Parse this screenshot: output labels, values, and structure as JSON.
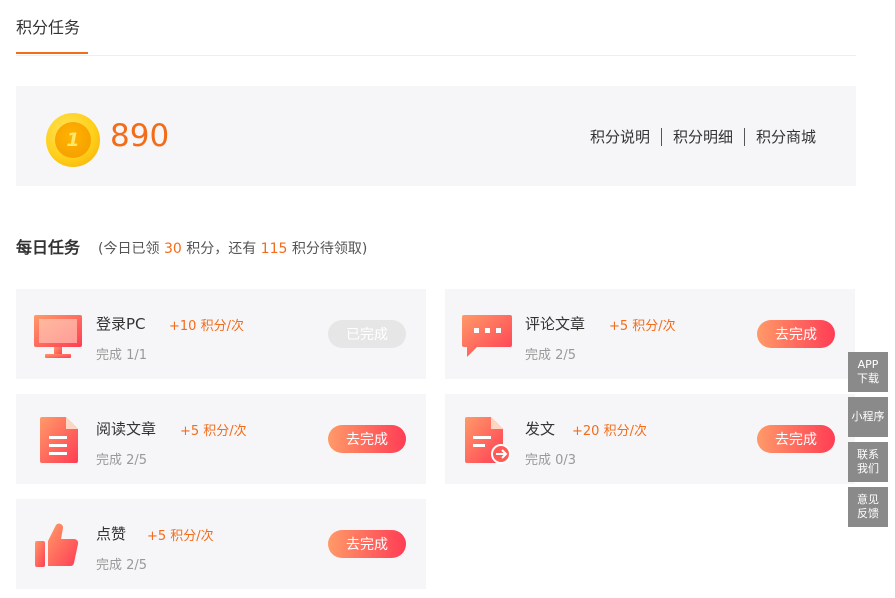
{
  "tabs": {
    "active": "积分任务"
  },
  "points": {
    "value": "890",
    "coin_symbol": "1",
    "links": [
      "积分说明",
      "积分明细",
      "积分商城"
    ]
  },
  "daily": {
    "title": "每日任务",
    "sub_prefix": "(今日已领 ",
    "earned": "30",
    "sub_middle": " 积分，还有 ",
    "remaining": "115",
    "sub_suffix": " 积分待领取)"
  },
  "tasks": [
    {
      "name": "登录PC",
      "points": "+10 积分/次",
      "progress": "完成 1/1",
      "button": "已完成",
      "icon": "monitor-icon",
      "done": true
    },
    {
      "name": "评论文章",
      "points": "+5 积分/次",
      "progress": "完成 2/5",
      "button": "去完成",
      "icon": "comment-icon",
      "done": false
    },
    {
      "name": "阅读文章",
      "points": "+5 积分/次",
      "progress": "完成 2/5",
      "button": "去完成",
      "icon": "document-icon",
      "done": false
    },
    {
      "name": "发文",
      "points": "+20 积分/次",
      "progress": "完成 0/3",
      "button": "去完成",
      "icon": "publish-icon",
      "done": false
    },
    {
      "name": "点赞",
      "points": "+5 积分/次",
      "progress": "完成 2/5",
      "button": "去完成",
      "icon": "thumbs-up-icon",
      "done": false
    }
  ],
  "sidebar": [
    {
      "line1": "APP",
      "line2": "下载"
    },
    {
      "line1": "小程序",
      "line2": ""
    },
    {
      "line1": "联系",
      "line2": "我们"
    },
    {
      "line1": "意见",
      "line2": "反馈"
    }
  ],
  "colors": {
    "accent": "#f36c1a",
    "button_start": "#ff9a68",
    "button_end": "#ff3d55",
    "panel_bg": "#f6f6f8"
  }
}
